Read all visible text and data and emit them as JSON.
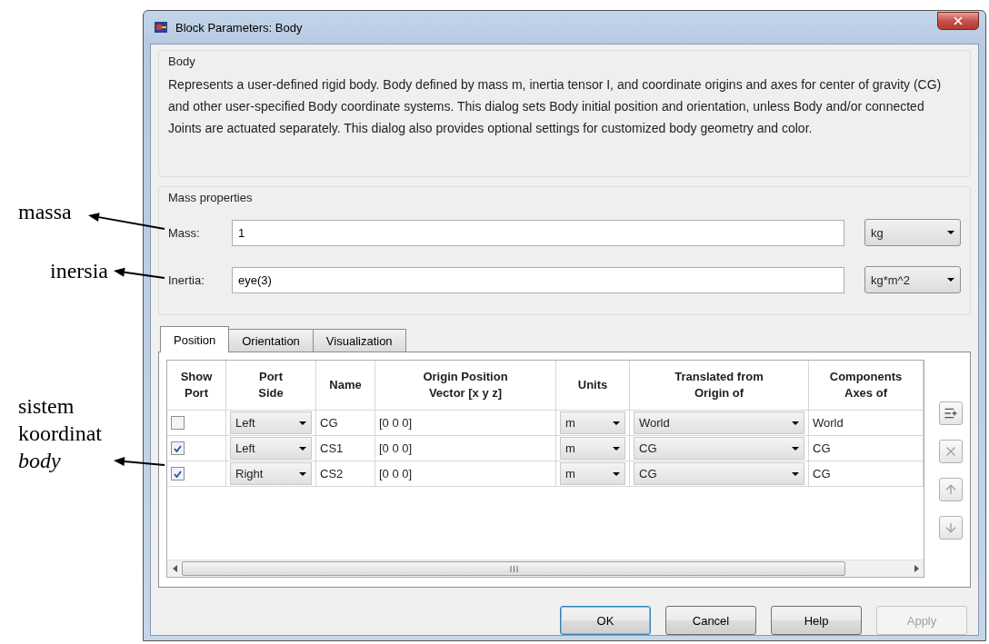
{
  "window": {
    "title": "Block Parameters: Body"
  },
  "description_group": {
    "title": "Body",
    "text": "Represents a user-defined rigid body. Body defined by mass m, inertia tensor I, and coordinate origins and axes for center of gravity (CG) and other user-specified Body coordinate systems. This dialog sets Body initial position and orientation, unless Body and/or connected Joints are actuated separately. This dialog also provides optional settings for customized body geometry and color."
  },
  "mass_properties": {
    "title": "Mass properties",
    "fields": [
      {
        "label": "Mass:",
        "value": "1",
        "unit": "kg"
      },
      {
        "label": "Inertia:",
        "value": "eye(3)",
        "unit": "kg*m^2"
      }
    ]
  },
  "tabs": [
    {
      "label": "Position",
      "selected": true
    },
    {
      "label": "Orientation",
      "selected": false
    },
    {
      "label": "Visualization",
      "selected": false
    }
  ],
  "table": {
    "columns": [
      "Show\nPort",
      "Port\nSide",
      "Name",
      "Origin Position\nVector [x y z]",
      "Units",
      "Translated from\nOrigin of",
      "Components\nAxes of"
    ],
    "rows": [
      {
        "show_port": false,
        "port_side": "Left",
        "name": "CG",
        "origin": "[0 0 0]",
        "units": "m",
        "translated_from": "World",
        "components_axes": "World"
      },
      {
        "show_port": true,
        "port_side": "Left",
        "name": "CS1",
        "origin": "[0 0 0]",
        "units": "m",
        "translated_from": "CG",
        "components_axes": "CG"
      },
      {
        "show_port": true,
        "port_side": "Right",
        "name": "CS2",
        "origin": "[0 0 0]",
        "units": "m",
        "translated_from": "CG",
        "components_axes": "CG"
      }
    ]
  },
  "buttons": [
    {
      "label": "OK",
      "default": true,
      "disabled": false
    },
    {
      "label": "Cancel",
      "default": false,
      "disabled": false
    },
    {
      "label": "Help",
      "default": false,
      "disabled": false
    },
    {
      "label": "Apply",
      "default": false,
      "disabled": true
    }
  ],
  "annotations": [
    {
      "text": "massa"
    },
    {
      "text": "inersia"
    },
    {
      "text": "sistem koordinat *body*"
    }
  ]
}
